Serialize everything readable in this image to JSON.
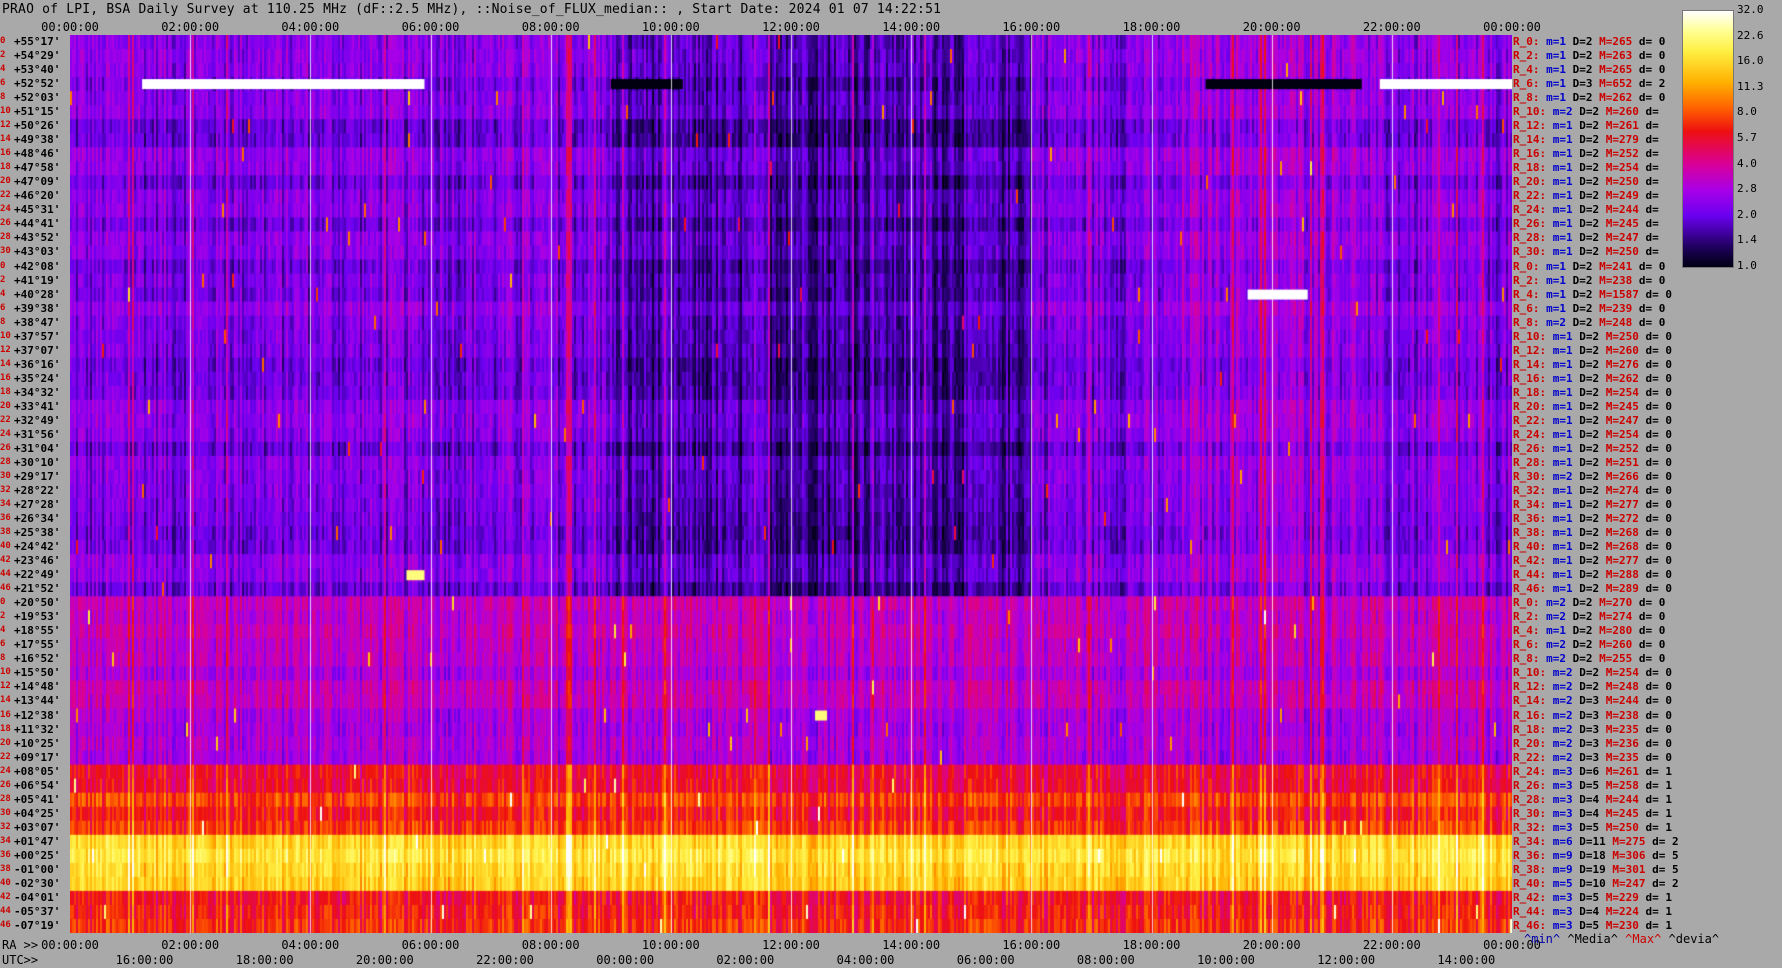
{
  "header": {
    "title": "PRAO of LPI, BSA Daily Survey at 110.25 MHz (dF::2.5 MHz), ::Noise_of_FLUX_median:: , Start Date: 2024 01 07 14:22:51"
  },
  "axes": {
    "top_ticks": [
      "00:00:00",
      "02:00:00",
      "04:00:00",
      "06:00:00",
      "08:00:00",
      "10:00:00",
      "12:00:00",
      "14:00:00",
      "16:00:00",
      "18:00:00",
      "20:00:00",
      "22:00:00",
      "00:00:00"
    ],
    "ra_label": "RA >>",
    "ra_ticks": [
      "00:00:00",
      "02:00:00",
      "04:00:00",
      "06:00:00",
      "08:00:00",
      "10:00:00",
      "12:00:00",
      "14:00:00",
      "16:00:00",
      "18:00:00",
      "20:00:00",
      "22:00:00",
      "00:00:00"
    ],
    "utc_label": "UTC>>",
    "utc_ticks": [
      "16:00:00",
      "18:00:00",
      "20:00:00",
      "22:00:00",
      "00:00:00",
      "02:00:00",
      "04:00:00",
      "06:00:00",
      "08:00:00",
      "10:00:00",
      "12:00:00",
      "14:00:00"
    ]
  },
  "row_numbers": [
    "0",
    "2",
    "4",
    "6",
    "8",
    "10",
    "12",
    "14",
    "16",
    "18",
    "20",
    "22",
    "24",
    "26",
    "28",
    "30",
    "0",
    "2",
    "4",
    "6",
    "8",
    "10",
    "12",
    "14",
    "16",
    "18",
    "20",
    "22",
    "24",
    "26",
    "28",
    "30",
    "32",
    "34",
    "36",
    "38",
    "40",
    "42",
    "44",
    "46",
    "0",
    "2",
    "4",
    "6",
    "8",
    "10",
    "12",
    "14",
    "16",
    "18",
    "20",
    "22",
    "24",
    "26",
    "28",
    "30",
    "32",
    "34",
    "36",
    "38",
    "40",
    "42",
    "44",
    "46"
  ],
  "declinations": [
    "+55°17'",
    "+54°29'",
    "+53°40'",
    "+52°52'",
    "+52°03'",
    "+51°15'",
    "+50°26'",
    "+49°38'",
    "+48°46'",
    "+47°58'",
    "+47°09'",
    "+46°20'",
    "+45°31'",
    "+44°41'",
    "+43°52'",
    "+43°03'",
    "+42°08'",
    "+41°19'",
    "+40°28'",
    "+39°38'",
    "+38°47'",
    "+37°57'",
    "+37°07'",
    "+36°16'",
    "+35°24'",
    "+34°32'",
    "+33°41'",
    "+32°49'",
    "+31°56'",
    "+31°04'",
    "+30°10'",
    "+29°17'",
    "+28°22'",
    "+27°28'",
    "+26°34'",
    "+25°38'",
    "+24°42'",
    "+23°46'",
    "+22°49'",
    "+21°52'",
    "+20°50'",
    "+19°53'",
    "+18°55'",
    "+17°55'",
    "+16°52'",
    "+15°50'",
    "+14°48'",
    "+13°44'",
    "+12°38'",
    "+11°32'",
    "+10°25'",
    "+09°17'",
    "+08°05'",
    "+06°54'",
    "+05°41'",
    "+04°25'",
    "+03°07'",
    "+01°47'",
    "+00°25'",
    "-01°00'",
    "-02°30'",
    "-04°01'",
    "-05°37'",
    "-07°19'"
  ],
  "stats": [
    {
      "r": "R_0:",
      "m": "m=1",
      "d": "D=2",
      "h": "M=265",
      "v": "d= 0"
    },
    {
      "r": "R_2:",
      "m": "m=1",
      "d": "D=2",
      "h": "M=263",
      "v": "d= 0"
    },
    {
      "r": "R_4:",
      "m": "m=1",
      "d": "D=2",
      "h": "M=265",
      "v": "d= 0"
    },
    {
      "r": "R_6:",
      "m": "m=1",
      "d": "D=3",
      "h": "M=652",
      "v": "d= 2"
    },
    {
      "r": "R_8:",
      "m": "m=1",
      "d": "D=2",
      "h": "M=262",
      "v": "d= 0"
    },
    {
      "r": "R_10:",
      "m": "m=2",
      "d": "D=2",
      "h": "M=260",
      "v": "d="
    },
    {
      "r": "R_12:",
      "m": "m=1",
      "d": "D=2",
      "h": "M=261",
      "v": "d="
    },
    {
      "r": "R_14:",
      "m": "m=1",
      "d": "D=2",
      "h": "M=279",
      "v": "d="
    },
    {
      "r": "R_16:",
      "m": "m=1",
      "d": "D=2",
      "h": "M=252",
      "v": "d="
    },
    {
      "r": "R_18:",
      "m": "m=1",
      "d": "D=2",
      "h": "M=254",
      "v": "d="
    },
    {
      "r": "R_20:",
      "m": "m=1",
      "d": "D=2",
      "h": "M=250",
      "v": "d="
    },
    {
      "r": "R_22:",
      "m": "m=1",
      "d": "D=2",
      "h": "M=249",
      "v": "d="
    },
    {
      "r": "R_24:",
      "m": "m=1",
      "d": "D=2",
      "h": "M=244",
      "v": "d="
    },
    {
      "r": "R_26:",
      "m": "m=1",
      "d": "D=2",
      "h": "M=245",
      "v": "d="
    },
    {
      "r": "R_28:",
      "m": "m=1",
      "d": "D=2",
      "h": "M=247",
      "v": "d="
    },
    {
      "r": "R_30:",
      "m": "m=1",
      "d": "D=2",
      "h": "M=250",
      "v": "d="
    },
    {
      "r": "R_0:",
      "m": "m=1",
      "d": "D=2",
      "h": "M=241",
      "v": "d= 0"
    },
    {
      "r": "R_2:",
      "m": "m=1",
      "d": "D=2",
      "h": "M=238",
      "v": "d= 0"
    },
    {
      "r": "R_4:",
      "m": "m=1",
      "d": "D=2",
      "h": "M=1587",
      "v": "d= 0"
    },
    {
      "r": "R_6:",
      "m": "m=1",
      "d": "D=2",
      "h": "M=239",
      "v": "d= 0"
    },
    {
      "r": "R_8:",
      "m": "m=2",
      "d": "D=2",
      "h": "M=248",
      "v": "d= 0"
    },
    {
      "r": "R_10:",
      "m": "m=1",
      "d": "D=2",
      "h": "M=250",
      "v": "d= 0"
    },
    {
      "r": "R_12:",
      "m": "m=1",
      "d": "D=2",
      "h": "M=260",
      "v": "d= 0"
    },
    {
      "r": "R_14:",
      "m": "m=1",
      "d": "D=2",
      "h": "M=276",
      "v": "d= 0"
    },
    {
      "r": "R_16:",
      "m": "m=1",
      "d": "D=2",
      "h": "M=262",
      "v": "d= 0"
    },
    {
      "r": "R_18:",
      "m": "m=1",
      "d": "D=2",
      "h": "M=254",
      "v": "d= 0"
    },
    {
      "r": "R_20:",
      "m": "m=1",
      "d": "D=2",
      "h": "M=245",
      "v": "d= 0"
    },
    {
      "r": "R_22:",
      "m": "m=1",
      "d": "D=2",
      "h": "M=247",
      "v": "d= 0"
    },
    {
      "r": "R_24:",
      "m": "m=1",
      "d": "D=2",
      "h": "M=254",
      "v": "d= 0"
    },
    {
      "r": "R_26:",
      "m": "m=1",
      "d": "D=2",
      "h": "M=252",
      "v": "d= 0"
    },
    {
      "r": "R_28:",
      "m": "m=1",
      "d": "D=2",
      "h": "M=251",
      "v": "d= 0"
    },
    {
      "r": "R_30:",
      "m": "m=2",
      "d": "D=2",
      "h": "M=266",
      "v": "d= 0"
    },
    {
      "r": "R_32:",
      "m": "m=1",
      "d": "D=2",
      "h": "M=274",
      "v": "d= 0"
    },
    {
      "r": "R_34:",
      "m": "m=1",
      "d": "D=2",
      "h": "M=277",
      "v": "d= 0"
    },
    {
      "r": "R_36:",
      "m": "m=1",
      "d": "D=2",
      "h": "M=272",
      "v": "d= 0"
    },
    {
      "r": "R_38:",
      "m": "m=1",
      "d": "D=2",
      "h": "M=268",
      "v": "d= 0"
    },
    {
      "r": "R_40:",
      "m": "m=1",
      "d": "D=2",
      "h": "M=268",
      "v": "d= 0"
    },
    {
      "r": "R_42:",
      "m": "m=1",
      "d": "D=2",
      "h": "M=277",
      "v": "d= 0"
    },
    {
      "r": "R_44:",
      "m": "m=1",
      "d": "D=2",
      "h": "M=288",
      "v": "d= 0"
    },
    {
      "r": "R_46:",
      "m": "m=1",
      "d": "D=2",
      "h": "M=289",
      "v": "d= 0"
    },
    {
      "r": "R_0:",
      "m": "m=2",
      "d": "D=2",
      "h": "M=270",
      "v": "d= 0"
    },
    {
      "r": "R_2:",
      "m": "m=2",
      "d": "D=2",
      "h": "M=274",
      "v": "d= 0"
    },
    {
      "r": "R_4:",
      "m": "m=1",
      "d": "D=2",
      "h": "M=280",
      "v": "d= 0"
    },
    {
      "r": "R_6:",
      "m": "m=2",
      "d": "D=2",
      "h": "M=260",
      "v": "d= 0"
    },
    {
      "r": "R_8:",
      "m": "m=2",
      "d": "D=2",
      "h": "M=255",
      "v": "d= 0"
    },
    {
      "r": "R_10:",
      "m": "m=2",
      "d": "D=2",
      "h": "M=254",
      "v": "d= 0"
    },
    {
      "r": "R_12:",
      "m": "m=2",
      "d": "D=2",
      "h": "M=248",
      "v": "d= 0"
    },
    {
      "r": "R_14:",
      "m": "m=2",
      "d": "D=3",
      "h": "M=244",
      "v": "d= 0"
    },
    {
      "r": "R_16:",
      "m": "m=2",
      "d": "D=3",
      "h": "M=238",
      "v": "d= 0"
    },
    {
      "r": "R_18:",
      "m": "m=2",
      "d": "D=3",
      "h": "M=235",
      "v": "d= 0"
    },
    {
      "r": "R_20:",
      "m": "m=2",
      "d": "D=3",
      "h": "M=236",
      "v": "d= 0"
    },
    {
      "r": "R_22:",
      "m": "m=2",
      "d": "D=3",
      "h": "M=235",
      "v": "d= 0"
    },
    {
      "r": "R_24:",
      "m": "m=3",
      "d": "D=6",
      "h": "M=261",
      "v": "d= 1"
    },
    {
      "r": "R_26:",
      "m": "m=3",
      "d": "D=5",
      "h": "M=258",
      "v": "d= 1"
    },
    {
      "r": "R_28:",
      "m": "m=3",
      "d": "D=4",
      "h": "M=244",
      "v": "d= 1"
    },
    {
      "r": "R_30:",
      "m": "m=3",
      "d": "D=4",
      "h": "M=245",
      "v": "d= 1"
    },
    {
      "r": "R_32:",
      "m": "m=3",
      "d": "D=5",
      "h": "M=250",
      "v": "d= 1"
    },
    {
      "r": "R_34:",
      "m": "m=6",
      "d": "D=11",
      "h": "M=275",
      "v": "d= 2"
    },
    {
      "r": "R_36:",
      "m": "m=9",
      "d": "D=18",
      "h": "M=306",
      "v": "d= 5"
    },
    {
      "r": "R_38:",
      "m": "m=9",
      "d": "D=19",
      "h": "M=301",
      "v": "d= 5"
    },
    {
      "r": "R_40:",
      "m": "m=5",
      "d": "D=10",
      "h": "M=247",
      "v": "d= 2"
    },
    {
      "r": "R_42:",
      "m": "m=3",
      "d": "D=5",
      "h": "M=229",
      "v": "d= 1"
    },
    {
      "r": "R_44:",
      "m": "m=3",
      "d": "D=4",
      "h": "M=224",
      "v": "d= 1"
    },
    {
      "r": "R_46:",
      "m": "m=3",
      "d": "D=5",
      "h": "M=230",
      "v": "d= 1"
    }
  ],
  "colorbar": {
    "labels": [
      "32.0",
      "22.6",
      "16.0",
      "11.3",
      "8.0",
      "5.7",
      "4.0",
      "2.8",
      "2.0",
      "1.4",
      "1.0"
    ],
    "colors": [
      "#ffffff",
      "#ffff90",
      "#ffee40",
      "#ffb000",
      "#ff6000",
      "#ee1010",
      "#d8009a",
      "#a800e8",
      "#6a00f0",
      "#200060",
      "#000010"
    ]
  },
  "footer": {
    "min": "^min^",
    "median": "^Media^",
    "max": "^Max^",
    "dev": "^devia^"
  },
  "chart_data": {
    "type": "heatmap",
    "title": "PRAO of LPI, BSA Daily Survey at 110.25 MHz (dF::2.5 MHz), ::Noise_of_FLUX_median:: , Start Date: 2024 01 07 14:22:51",
    "x_axis": "RA 00:00:00 to 24:00:00",
    "y_axis": "Declination +55°17' to -07°19'",
    "n_rows": 64,
    "color_scale_range": [
      1.0,
      32.0
    ],
    "color_scale_log": true,
    "background_level": 2.8,
    "band_levels": [
      {
        "from_row": 0,
        "to_row": 39,
        "level": 2.2
      },
      {
        "from_row": 40,
        "to_row": 51,
        "level": 3.2
      },
      {
        "from_row": 52,
        "to_row": 56,
        "level": 6.5
      },
      {
        "from_row": 57,
        "to_row": 60,
        "level": 16.0
      },
      {
        "from_row": 61,
        "to_row": 63,
        "level": 7.0
      }
    ],
    "features": [
      {
        "row": 3,
        "ra_start": 1.2,
        "ra_end": 5.9,
        "level": 32.0
      },
      {
        "row": 3,
        "ra_start": 21.8,
        "ra_end": 24.0,
        "level": 32.0
      },
      {
        "row": 3,
        "ra_start": 18.9,
        "ra_end": 21.5,
        "level": 1.0
      },
      {
        "row": 3,
        "ra_start": 9.0,
        "ra_end": 10.2,
        "level": 1.0
      },
      {
        "row": 18,
        "ra_start": 19.6,
        "ra_end": 20.6,
        "level": 32.0
      },
      {
        "row": 38,
        "ra_start": 5.6,
        "ra_end": 5.9,
        "level": 22.6
      },
      {
        "row": 48,
        "ra_start": 12.4,
        "ra_end": 12.6,
        "level": 22.6
      },
      {
        "row": 6,
        "ra_start": 24.0,
        "ra_end": 24.0,
        "level": 0
      }
    ]
  }
}
